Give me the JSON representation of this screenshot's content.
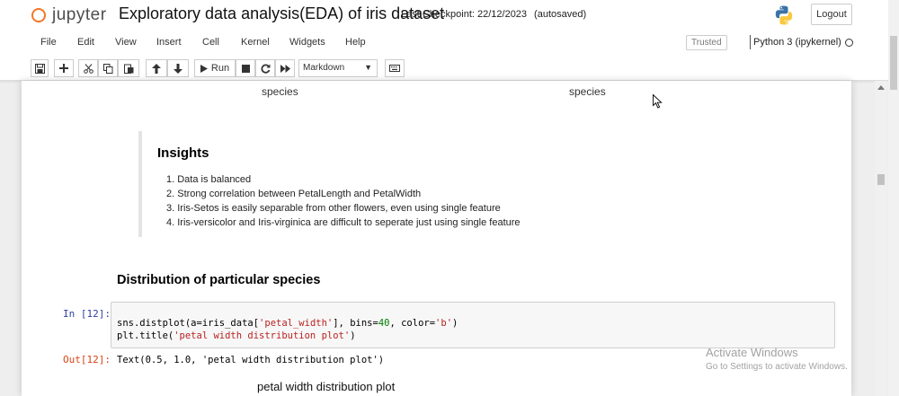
{
  "header": {
    "logo_text": "jupyter",
    "notebook_title": "Exploratory data analysis(EDA) of iris dataset",
    "checkpoint": "Last Checkpoint: 22/12/2023",
    "autosave": "(autosaved)",
    "logout_label": "Logout"
  },
  "menubar": {
    "items": [
      "File",
      "Edit",
      "View",
      "Insert",
      "Cell",
      "Kernel",
      "Widgets",
      "Help"
    ],
    "trusted": "Trusted",
    "kernel": "Python 3 (ipykernel)"
  },
  "toolbar": {
    "run_label": "Run",
    "cell_type": "Markdown",
    "icons": [
      "save-icon",
      "add-cell-icon",
      "cut-icon",
      "copy-icon",
      "paste-icon",
      "move-up-icon",
      "move-down-icon",
      "run-icon",
      "stop-icon",
      "restart-icon",
      "fast-forward-icon",
      "keyboard-icon"
    ]
  },
  "notebook": {
    "axis_labels": [
      "species",
      "species"
    ],
    "insights": {
      "title": "Insights",
      "items": [
        "1. Data is balanced",
        "2. Strong correlation between PetalLength and PetalWidth",
        "3. Iris-Setos is easily separable from other flowers, even using single feature",
        "4. Iris-versicolor and Iris-virginica are difficult to seperate just using single feature"
      ]
    },
    "section_heading": "Distribution of particular species",
    "code_cell": {
      "in_prompt": "In [12]:",
      "line1": {
        "p1": "sns.distplot(a=iris_data[",
        "s1": "'petal_width'",
        "p2": "], bins=",
        "n1": "40",
        "p3": ", color=",
        "s2": "'b'",
        "p4": ")"
      },
      "line2": {
        "p1": "plt.title(",
        "s1": "'petal width distribution plot'",
        "p2": ")"
      }
    },
    "output": {
      "out_prompt": "Out[12]:",
      "text": "Text(0.5, 1.0, 'petal width distribution plot')"
    },
    "plot_title": "petal width distribution plot"
  },
  "watermark": {
    "title": "Activate Windows",
    "subtitle": "Go to Settings to activate Windows."
  },
  "colors": {
    "jupyter_orange": "#f37726",
    "in_prompt": "#303f9f",
    "out_prompt": "#d84315",
    "string": "#ba2121",
    "number": "#008000"
  }
}
